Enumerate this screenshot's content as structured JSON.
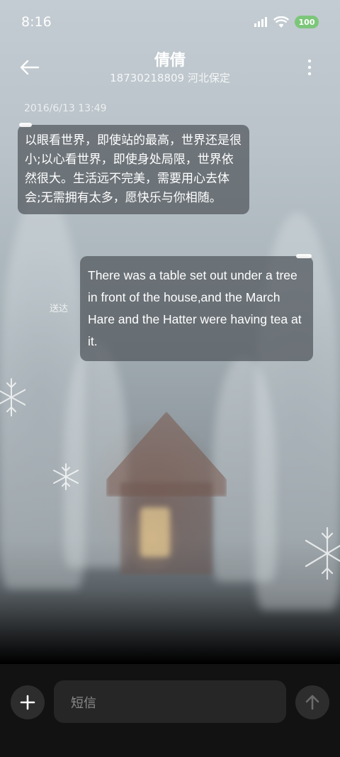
{
  "status_bar": {
    "time": "8:16",
    "battery_level": "100",
    "icons": [
      "signal-icon",
      "wifi-icon",
      "battery-icon"
    ]
  },
  "header": {
    "title": "倩倩",
    "subtitle": "18730218809 河北保定",
    "back_icon": "back-arrow-icon",
    "menu_icon": "more-vertical-icon"
  },
  "conversation": {
    "timestamp": "2016/6/13 13:49",
    "messages": [
      {
        "direction": "incoming",
        "text": "以眼看世界，即使站的最高，世界还是很小;以心看世界，即使身处局限，世界依然很大。生活远不完美，需要用心去体会;无需拥有太多，愿快乐与你相随。"
      },
      {
        "direction": "outgoing",
        "text": "There was a table set out under a tree in front of the house,and the March Hare and the Hatter were having tea at it.",
        "status": "送达"
      }
    ]
  },
  "composer": {
    "placeholder": "短信",
    "add_icon": "plus-icon",
    "send_icon": "send-arrow-icon"
  },
  "colors": {
    "battery": "#7cc67a",
    "bubble": "#50565c",
    "composer_bg": "#121212"
  }
}
